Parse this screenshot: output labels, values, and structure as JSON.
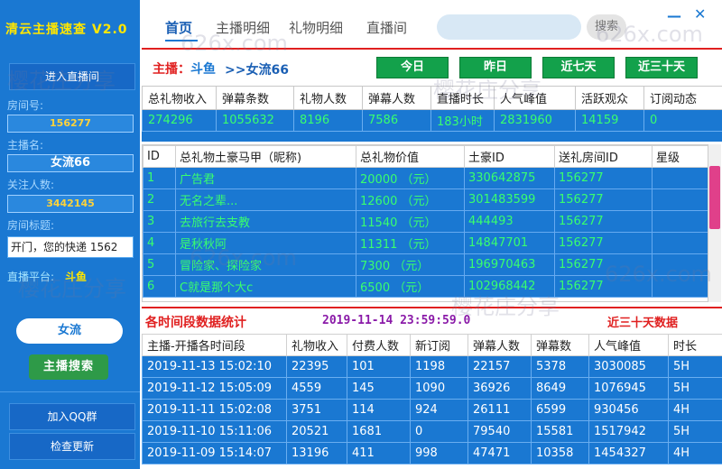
{
  "app": {
    "title": "清云主播速查 V2.0"
  },
  "sidebar": {
    "enter_room_label": "进入直播间",
    "room_id_label": "房间号:",
    "room_id_value": "156277",
    "host_name_label": "主播名:",
    "host_name_value": "女流66",
    "followers_label": "关注人数:",
    "followers_value": "3442145",
    "room_title_label": "房间标题:",
    "room_title_value": "开门，您的快递 1562",
    "platform_label": "直播平台:",
    "platform_value": "斗鱼",
    "search_value": "女流",
    "search_button_label": "主播搜索",
    "qq_group_label": "加入QQ群",
    "check_update_label": "检查更新"
  },
  "topnav": {
    "tabs": [
      {
        "label": "首页",
        "active": true
      },
      {
        "label": "主播明细",
        "active": false
      },
      {
        "label": "礼物明细",
        "active": false
      },
      {
        "label": "直播间",
        "active": false
      }
    ],
    "search_placeholder": "",
    "search_button_label": "搜索",
    "minimize_label": "—",
    "close_label": "✕"
  },
  "host_row": {
    "prefix": "主播：",
    "platform": "斗鱼",
    "name": ">>女流66",
    "range_buttons": [
      "今日",
      "昨日",
      "近七天",
      "近三十天"
    ]
  },
  "stats": {
    "headers": [
      "总礼物收入",
      "弹幕条数",
      "礼物人数",
      "弹幕人数",
      "直播时长",
      "人气峰值",
      "活跃观众",
      "订阅动态"
    ],
    "values": [
      "274296",
      "1055632",
      "8196",
      "7586",
      "183小时",
      "2831960",
      "14159",
      "0"
    ]
  },
  "gifters": {
    "headers": [
      "ID",
      "总礼物土豪马甲（昵称)",
      "总礼物价值",
      "土豪ID",
      "送礼房间ID",
      "星级"
    ],
    "rows": [
      [
        "1",
        "广告君",
        "20000 （元）",
        "330642875",
        "156277",
        ""
      ],
      [
        "2",
        "无名之辈...",
        "12600 （元）",
        "301483599",
        "156277",
        ""
      ],
      [
        "3",
        "去旅行去支教",
        "11540 （元）",
        "444493",
        "156277",
        ""
      ],
      [
        "4",
        "是秋秋阿",
        "11311 （元）",
        "14847701",
        "156277",
        ""
      ],
      [
        "5",
        "冒险家、探险家",
        "7300 （元）",
        "196970463",
        "156277",
        ""
      ],
      [
        "6",
        "C就是那个大c",
        "6500 （元）",
        "102968442",
        "156277",
        ""
      ]
    ]
  },
  "time_section": {
    "title": "各时间段数据统计",
    "timestamp": "2019-11-14 23:59:59.0",
    "range_label": "近三十天数据",
    "headers": [
      "主播-开播各时间段",
      "礼物收入",
      "付费人数",
      "新订阅",
      "弹幕人数",
      "弹幕数",
      "人气峰值",
      "时长"
    ],
    "rows": [
      [
        "2019-11-13 15:02:10",
        "22395",
        "101",
        "1198",
        "22157",
        "5378",
        "3030085",
        "5H"
      ],
      [
        "2019-11-12 15:05:09",
        "4559",
        "145",
        "1090",
        "36926",
        "8649",
        "1076945",
        "5H"
      ],
      [
        "2019-11-11 15:02:08",
        "3751",
        "114",
        "924",
        "26111",
        "6599",
        "930456",
        "4H"
      ],
      [
        "2019-11-10 15:11:06",
        "20521",
        "1681",
        "0",
        "79540",
        "15581",
        "1517942",
        "5H"
      ],
      [
        "2019-11-09 15:14:07",
        "13196",
        "411",
        "998",
        "47471",
        "10358",
        "1454327",
        "4H"
      ]
    ]
  },
  "watermarks": [
    "樱花庄分享",
    "626x.com",
    "樱花庄分享",
    "626x.com",
    "樱花庄分享",
    "626x.com",
    "樱花庄分享",
    "626x.com"
  ]
}
